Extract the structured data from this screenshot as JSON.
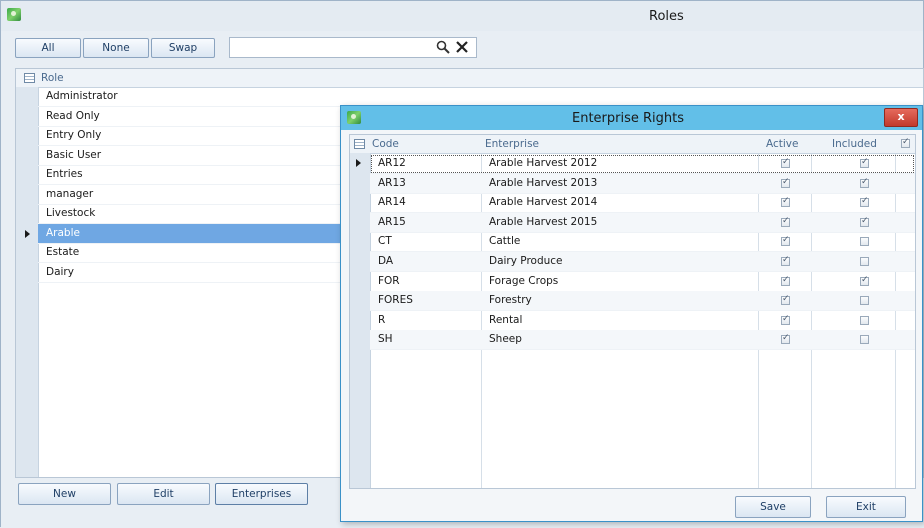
{
  "window": {
    "title": "Roles"
  },
  "toolbar": {
    "all_label": "All",
    "none_label": "None",
    "swap_label": "Swap"
  },
  "search": {
    "value": "",
    "search_icon": "search-icon",
    "clear_icon": "close-icon"
  },
  "roles_grid": {
    "header": "Role",
    "selected_index": 7,
    "items": [
      "Administrator",
      "Read Only",
      "Entry Only",
      "Basic User",
      "Entries",
      "manager",
      "Livestock",
      "Arable",
      "Estate",
      "Dairy"
    ]
  },
  "bottom_buttons": {
    "new_label": "New",
    "edit_label": "Edit",
    "enterprises_label": "Enterprises"
  },
  "dialog": {
    "title": "Enterprise Rights",
    "close_label": "x",
    "columns": {
      "code": "Code",
      "enterprise": "Enterprise",
      "active": "Active",
      "included": "Included"
    },
    "header_checkbox_checked": true,
    "rows": [
      {
        "code": "AR12",
        "name": "Arable Harvest 2012",
        "active": true,
        "included": true
      },
      {
        "code": "AR13",
        "name": "Arable Harvest 2013",
        "active": true,
        "included": true
      },
      {
        "code": "AR14",
        "name": "Arable Harvest 2014",
        "active": true,
        "included": true
      },
      {
        "code": "AR15",
        "name": "Arable Harvest 2015",
        "active": true,
        "included": true
      },
      {
        "code": "CT",
        "name": "Cattle",
        "active": true,
        "included": false
      },
      {
        "code": "DA",
        "name": "Dairy Produce",
        "active": true,
        "included": false
      },
      {
        "code": "FOR",
        "name": "Forage Crops",
        "active": true,
        "included": true
      },
      {
        "code": "FORES",
        "name": "Forestry",
        "active": true,
        "included": false
      },
      {
        "code": "R",
        "name": "Rental",
        "active": true,
        "included": false
      },
      {
        "code": "SH",
        "name": "Sheep",
        "active": true,
        "included": false
      }
    ],
    "save_label": "Save",
    "exit_label": "Exit"
  },
  "colors": {
    "selection": "#6fa7e3",
    "dialog_title": "#62bfe8",
    "close_button": "#c9463a"
  }
}
